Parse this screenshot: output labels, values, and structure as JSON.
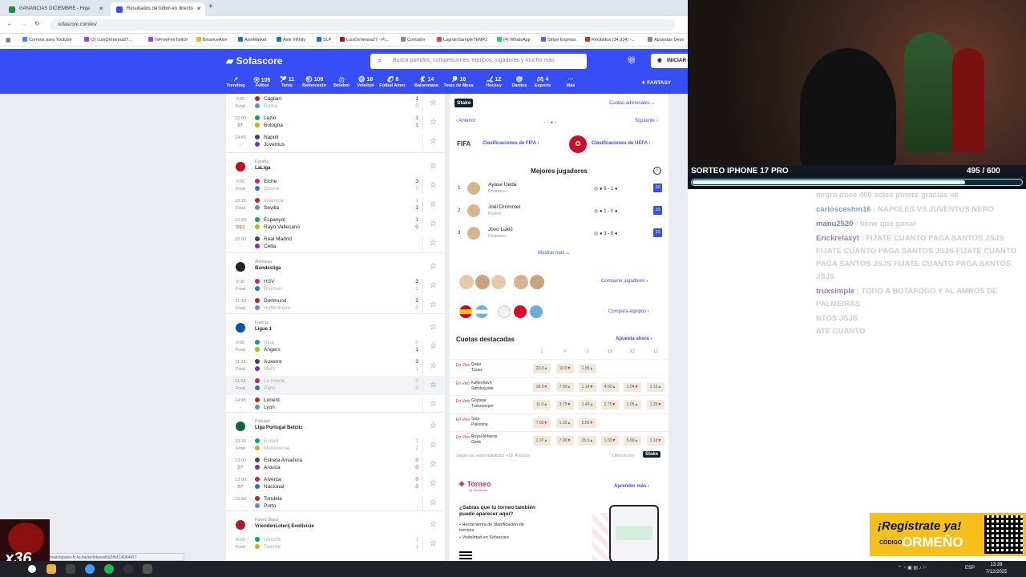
{
  "browser": {
    "tabs": [
      {
        "label": "GANANCIAS DICIEMBRE - Hoja",
        "color": "#1e8e3e"
      },
      {
        "label": "Resultados de fútbol en directo",
        "color": "#374df5"
      }
    ],
    "url": "sofascore.com/es/",
    "bookmarks": [
      "Correos para Youtube",
      "(2) LuisOrmenoa27...",
      "%FreeFireTwitch",
      "BinanceAxie",
      "AxieMarket",
      "Axie Infinity",
      "SLP",
      "LuisOrmenoa27 - Pi...",
      "Contador",
      "LagrainSampleTEMP2",
      "(4) WhatsApp",
      "Stripe Express",
      "Recibidos (34,934) -...",
      "Apuestas Depo"
    ],
    "status_url": "sofascore.com/es/football/match/paris-fc-le-havre/mbswsKbZ#id:14064417"
  },
  "header": {
    "logo": "Sofascore",
    "search_placeholder": "Busca partidos, competiciones, equipos, jugadores y mucho más",
    "login": "INICIAR",
    "fantasy": "FANTASY",
    "sports": [
      {
        "label": "Trending",
        "count": ""
      },
      {
        "label": "Fútbol",
        "count": "105"
      },
      {
        "label": "Tenis",
        "count": "11"
      },
      {
        "label": "Baloncesto",
        "count": "108"
      },
      {
        "label": "Béisbol",
        "count": ""
      },
      {
        "label": "Voleibol",
        "count": "18"
      },
      {
        "label": "Fútbol Amer.",
        "count": "8"
      },
      {
        "label": "Balonmano",
        "count": "14"
      },
      {
        "label": "Tenis de Mesa",
        "count": "16"
      },
      {
        "label": "Hockey",
        "count": "12"
      },
      {
        "label": "Dardos",
        "count": ""
      },
      {
        "label": "Esports",
        "count": "4"
      },
      {
        "label": "Más",
        "count": ""
      }
    ]
  },
  "matches": {
    "italy_rows": [
      {
        "time": "9:00",
        "status": "Final",
        "home": "Cagliari",
        "away": "Roma",
        "hs": "1",
        "as": "0",
        "hdim": false,
        "adim": true,
        "live": false
      },
      {
        "time": "12:00",
        "status": "67'",
        "home": "Lazio",
        "away": "Bologna",
        "hs": "1",
        "as": "1",
        "hdim": false,
        "adim": false,
        "live": true
      },
      {
        "time": "14:45",
        "status": "-",
        "home": "Napoli",
        "away": "Juventus",
        "hs": "",
        "as": "",
        "hdim": false,
        "adim": false,
        "live": false
      }
    ],
    "leagues": [
      {
        "country": "España",
        "name": "LaLiga",
        "flag": "#c60b1e",
        "rows": [
          {
            "time": "9:00",
            "status": "Final",
            "home": "Elche",
            "away": "Girona",
            "hs": "3",
            "as": "0",
            "hdim": false,
            "adim": true,
            "live": false
          },
          {
            "time": "10:15",
            "status": "Final",
            "home": "Valencia",
            "away": "Sevilla",
            "hs": "1",
            "as": "1",
            "hdim": true,
            "adim": false,
            "live": false
          },
          {
            "time": "12:30",
            "status": "DES",
            "home": "Espanyol",
            "away": "Rayo Vallecano",
            "hs": "1",
            "as": "0",
            "hdim": false,
            "adim": false,
            "live": true
          },
          {
            "time": "15:00",
            "status": "-",
            "home": "Real Madrid",
            "away": "Celta",
            "hs": "",
            "as": "",
            "hdim": false,
            "adim": false,
            "live": false
          }
        ]
      },
      {
        "country": "Alemania",
        "name": "Bundesliga",
        "flag": "#222",
        "rows": [
          {
            "time": "9:30",
            "status": "Final",
            "home": "HSV",
            "away": "Bremen",
            "hs": "3",
            "as": "2",
            "hdim": false,
            "adim": true,
            "live": false
          },
          {
            "time": "11:30",
            "status": "Final",
            "home": "Dortmund",
            "away": "Hoffenheim",
            "hs": "2",
            "as": "0",
            "hdim": false,
            "adim": true,
            "live": false
          }
        ]
      },
      {
        "country": "Francia",
        "name": "Ligue 1",
        "flag": "#0055a4",
        "rows": [
          {
            "time": "9:00",
            "status": "Final",
            "home": "Nice",
            "away": "Angers",
            "hs": "0",
            "as": "1",
            "hdim": true,
            "adim": false,
            "live": false
          },
          {
            "time": "11:15",
            "status": "Final",
            "home": "Auxerre",
            "away": "Metz",
            "hs": "3",
            "as": "1",
            "hdim": false,
            "adim": true,
            "live": false
          },
          {
            "time": "11:15",
            "status": "Final",
            "home": "Le Havre",
            "away": "Paris",
            "hs": "0",
            "as": "0",
            "hdim": true,
            "adim": true,
            "live": false
          },
          {
            "time": "14:45",
            "status": "-",
            "home": "Lorient",
            "away": "Lyon",
            "hs": "",
            "as": "",
            "hdim": false,
            "adim": false,
            "live": false
          }
        ]
      },
      {
        "country": "Portugal",
        "name": "Liga Portugal Betclic",
        "flag": "#046a38",
        "rows": [
          {
            "time": "10:30",
            "status": "Final",
            "home": "Estoril",
            "away": "Moreirense",
            "hs": "3",
            "as": "2",
            "hdim": true,
            "adim": true,
            "live": false
          },
          {
            "time": "13:00",
            "status": "27'",
            "home": "Estrela Amadora",
            "away": "Arouca",
            "hs": "0",
            "as": "0",
            "hdim": false,
            "adim": false,
            "live": true
          },
          {
            "time": "13:00",
            "status": "27'",
            "home": "Alverca",
            "away": "Nacional",
            "hs": "0",
            "as": "0",
            "hdim": false,
            "adim": false,
            "live": true
          },
          {
            "time": "15:30",
            "status": "-",
            "home": "Tondela",
            "away": "Porto",
            "hs": "",
            "as": "",
            "hdim": false,
            "adim": false,
            "live": false
          }
        ]
      },
      {
        "country": "Países Bajos",
        "name": "VriendenLoterij Eredivisie",
        "flag": "#ae1c28",
        "rows": [
          {
            "time": "8:15",
            "status": "Final",
            "home": "Utrecht",
            "away": "Twente",
            "hs": "1",
            "as": "1",
            "hdim": true,
            "adim": true,
            "live": false
          }
        ]
      }
    ]
  },
  "right": {
    "stake": "Stake",
    "cuotas_adicionales": "Cuotas adicionales",
    "anterior": "Anterior",
    "siguiente": "Siguiente",
    "fifa_logo": "FIFA",
    "fifa_link": "Clasificaciones de FIFA",
    "uefa_link": "Clasificaciones de UEFA",
    "best_title": "Mejores jugadores",
    "players": [
      {
        "rank": "1",
        "name": "Ayase Ueda",
        "pos": "Delantero",
        "match": "6 - 1",
        "rating": "10"
      },
      {
        "rank": "2",
        "name": "Joël Drommel",
        "pos": "Portero",
        "match": "1 - 0",
        "rating": "10"
      },
      {
        "rank": "3",
        "name": "Jovo Lukić",
        "pos": "Delantero",
        "match": "3 - 0",
        "rating": "10"
      }
    ],
    "mostrar_mas": "Mostrar más",
    "comparar_jugadores": "Comparar jugadores",
    "compara_equipos": "Compara equipos",
    "odds_title": "Cuotas destacadas",
    "apuesta_ahora": "Apuesta ahora",
    "odds_headers": [
      "1",
      "X",
      "2",
      "1X",
      "X2",
      "12"
    ],
    "en_vivo": "En Vivo",
    "odds_rows": [
      {
        "home": "Qatar",
        "away": "Túnez",
        "odds": [
          "23.0",
          "10.0",
          "1.06",
          "",
          "",
          ""
        ]
      },
      {
        "home": "København",
        "away": "Sønderjyske",
        "odds": [
          "18.0",
          "7.00",
          "1.14",
          "4.00",
          "1.04",
          "1.13"
        ]
      },
      {
        "home": "Göztepe",
        "away": "Trabzonspor",
        "odds": [
          "11.0",
          "3.75",
          "1.40",
          "2.75",
          "1.05",
          "1.25"
        ]
      },
      {
        "home": "Siria",
        "away": "Palestina",
        "odds": [
          "7.00",
          "1.33",
          "5.50",
          "",
          "",
          ""
        ]
      },
      {
        "home": "Royal Antwerp",
        "away": "Genk",
        "odds": [
          "1.37",
          "7.00",
          "15.0",
          "1.03",
          "5.00",
          "1.10"
        ]
      }
    ],
    "responsible": "Juega con responsabilidad. +18. Anuncio.",
    "ofrecido_por": "Ofrecido por",
    "torneo": "Torneo",
    "torneo_sub": "by Sofascore",
    "aprender_mas": "Aprender más",
    "torneo_q": "¿Sabías que tu torneo también puede aparecer aquí?",
    "torneo_b1": "Herramienta de planificación de torneos",
    "torneo_b2": "Visibilidad en Sofascore"
  },
  "stream": {
    "banner_title": "SORTEO IPHONE 17 PRO",
    "progress_text": "495  / 600",
    "progress_fraction": 0.825,
    "chat": [
      {
        "user": "",
        "msg": "negro doce 400 soles pinore gracias ue",
        "ucolor": "#c9ccd4"
      },
      {
        "user": "carlosceshm16",
        "msg": ": NÁPOLES VS JUVENTUS NERO",
        "ucolor": "#7fa1c8"
      },
      {
        "user": "manu2520",
        "msg": ": tiene que ganar",
        "ucolor": "#6f86b8"
      },
      {
        "user": "Erickrelaxyt",
        "msg": ": FIJATE CUANTO PAGA SANTOS JSJS FIJATE CUANTO PAGA SANTOS JSJS FIJATE CUANTO PAGA SANTOS JSJS FIJATE CUANTO PAGA SANTOS JSJS",
        "ucolor": "#a07ad0"
      },
      {
        "user": "truxsimple",
        "msg": ": TODO A BOTAFOGO Y AL AMBOS DE PALMEIRAS",
        "ucolor": "#9e77d6"
      },
      {
        "user": "",
        "msg": "NTOS JSJS",
        "ucolor": "#c9ccd4"
      },
      {
        "user": "",
        "msg": "ATE CUANTO",
        "ucolor": "#c9ccd4"
      }
    ],
    "promo_main": "¡Regístrate ya!",
    "promo_code_label": "CÓDIGO:",
    "promo_code": "ORMEÑO",
    "counter": "x36"
  },
  "taskbar": {
    "lang": "ESP",
    "time": "13:28",
    "date": "7/12/2025"
  }
}
